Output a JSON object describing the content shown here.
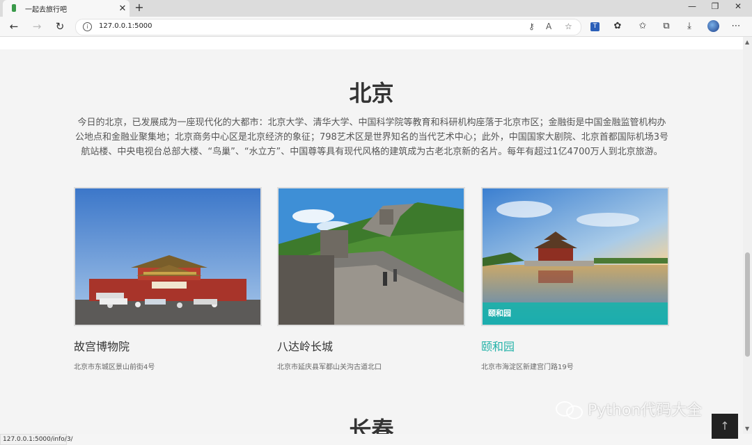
{
  "browser": {
    "tab_title": "一起去旅行吧",
    "new_tab": "+",
    "url": "127.0.0.1:5000",
    "status_url": "127.0.0.1:5000/info/3/"
  },
  "sections": [
    {
      "title": "北京",
      "intro": "今日的北京，已发展成为一座现代化的大都市：北京大学、清华大学、中国科学院等教育和科研机构座落于北京市区；金融街是中国金融监管机构办公地点和金融业聚集地；北京商务中心区是北京经济的象征；798艺术区是世界知名的当代艺术中心；此外，中国国家大剧院、北京首都国际机场3号航站楼、中央电视台总部大楼、“鸟巢”、“水立方”、中国尊等具有现代风格的建筑成为古老北京新的名片。每年有超过1亿4700万人到北京旅游。",
      "cards": [
        {
          "name": "故宫博物院",
          "address": "北京市东城区景山前街4号",
          "caption": ""
        },
        {
          "name": "八达岭长城",
          "address": "北京市延庆县军都山关沟古道北口",
          "caption": ""
        },
        {
          "name": "颐和园",
          "address": "北京市海淀区新建宫门路19号",
          "caption": "颐和园"
        }
      ]
    },
    {
      "title": "长春"
    }
  ],
  "watermark": "Python代码大全",
  "back_to_top": "↑",
  "colors": {
    "accent": "#23b2a8",
    "heading": "#333333",
    "text": "#555555"
  }
}
